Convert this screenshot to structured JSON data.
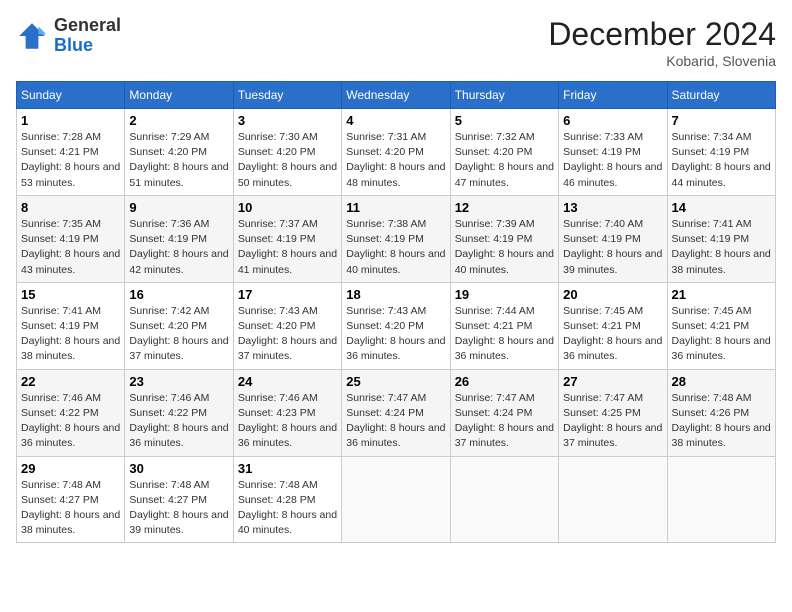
{
  "header": {
    "logo_line1": "General",
    "logo_line2": "Blue",
    "month": "December 2024",
    "location": "Kobarid, Slovenia"
  },
  "weekdays": [
    "Sunday",
    "Monday",
    "Tuesday",
    "Wednesday",
    "Thursday",
    "Friday",
    "Saturday"
  ],
  "weeks": [
    [
      {
        "day": "1",
        "sunrise": "7:28 AM",
        "sunset": "4:21 PM",
        "daylight": "8 hours and 53 minutes."
      },
      {
        "day": "2",
        "sunrise": "7:29 AM",
        "sunset": "4:20 PM",
        "daylight": "8 hours and 51 minutes."
      },
      {
        "day": "3",
        "sunrise": "7:30 AM",
        "sunset": "4:20 PM",
        "daylight": "8 hours and 50 minutes."
      },
      {
        "day": "4",
        "sunrise": "7:31 AM",
        "sunset": "4:20 PM",
        "daylight": "8 hours and 48 minutes."
      },
      {
        "day": "5",
        "sunrise": "7:32 AM",
        "sunset": "4:20 PM",
        "daylight": "8 hours and 47 minutes."
      },
      {
        "day": "6",
        "sunrise": "7:33 AM",
        "sunset": "4:19 PM",
        "daylight": "8 hours and 46 minutes."
      },
      {
        "day": "7",
        "sunrise": "7:34 AM",
        "sunset": "4:19 PM",
        "daylight": "8 hours and 44 minutes."
      }
    ],
    [
      {
        "day": "8",
        "sunrise": "7:35 AM",
        "sunset": "4:19 PM",
        "daylight": "8 hours and 43 minutes."
      },
      {
        "day": "9",
        "sunrise": "7:36 AM",
        "sunset": "4:19 PM",
        "daylight": "8 hours and 42 minutes."
      },
      {
        "day": "10",
        "sunrise": "7:37 AM",
        "sunset": "4:19 PM",
        "daylight": "8 hours and 41 minutes."
      },
      {
        "day": "11",
        "sunrise": "7:38 AM",
        "sunset": "4:19 PM",
        "daylight": "8 hours and 40 minutes."
      },
      {
        "day": "12",
        "sunrise": "7:39 AM",
        "sunset": "4:19 PM",
        "daylight": "8 hours and 40 minutes."
      },
      {
        "day": "13",
        "sunrise": "7:40 AM",
        "sunset": "4:19 PM",
        "daylight": "8 hours and 39 minutes."
      },
      {
        "day": "14",
        "sunrise": "7:41 AM",
        "sunset": "4:19 PM",
        "daylight": "8 hours and 38 minutes."
      }
    ],
    [
      {
        "day": "15",
        "sunrise": "7:41 AM",
        "sunset": "4:19 PM",
        "daylight": "8 hours and 38 minutes."
      },
      {
        "day": "16",
        "sunrise": "7:42 AM",
        "sunset": "4:20 PM",
        "daylight": "8 hours and 37 minutes."
      },
      {
        "day": "17",
        "sunrise": "7:43 AM",
        "sunset": "4:20 PM",
        "daylight": "8 hours and 37 minutes."
      },
      {
        "day": "18",
        "sunrise": "7:43 AM",
        "sunset": "4:20 PM",
        "daylight": "8 hours and 36 minutes."
      },
      {
        "day": "19",
        "sunrise": "7:44 AM",
        "sunset": "4:21 PM",
        "daylight": "8 hours and 36 minutes."
      },
      {
        "day": "20",
        "sunrise": "7:45 AM",
        "sunset": "4:21 PM",
        "daylight": "8 hours and 36 minutes."
      },
      {
        "day": "21",
        "sunrise": "7:45 AM",
        "sunset": "4:21 PM",
        "daylight": "8 hours and 36 minutes."
      }
    ],
    [
      {
        "day": "22",
        "sunrise": "7:46 AM",
        "sunset": "4:22 PM",
        "daylight": "8 hours and 36 minutes."
      },
      {
        "day": "23",
        "sunrise": "7:46 AM",
        "sunset": "4:22 PM",
        "daylight": "8 hours and 36 minutes."
      },
      {
        "day": "24",
        "sunrise": "7:46 AM",
        "sunset": "4:23 PM",
        "daylight": "8 hours and 36 minutes."
      },
      {
        "day": "25",
        "sunrise": "7:47 AM",
        "sunset": "4:24 PM",
        "daylight": "8 hours and 36 minutes."
      },
      {
        "day": "26",
        "sunrise": "7:47 AM",
        "sunset": "4:24 PM",
        "daylight": "8 hours and 37 minutes."
      },
      {
        "day": "27",
        "sunrise": "7:47 AM",
        "sunset": "4:25 PM",
        "daylight": "8 hours and 37 minutes."
      },
      {
        "day": "28",
        "sunrise": "7:48 AM",
        "sunset": "4:26 PM",
        "daylight": "8 hours and 38 minutes."
      }
    ],
    [
      {
        "day": "29",
        "sunrise": "7:48 AM",
        "sunset": "4:27 PM",
        "daylight": "8 hours and 38 minutes."
      },
      {
        "day": "30",
        "sunrise": "7:48 AM",
        "sunset": "4:27 PM",
        "daylight": "8 hours and 39 minutes."
      },
      {
        "day": "31",
        "sunrise": "7:48 AM",
        "sunset": "4:28 PM",
        "daylight": "8 hours and 40 minutes."
      },
      null,
      null,
      null,
      null
    ]
  ]
}
